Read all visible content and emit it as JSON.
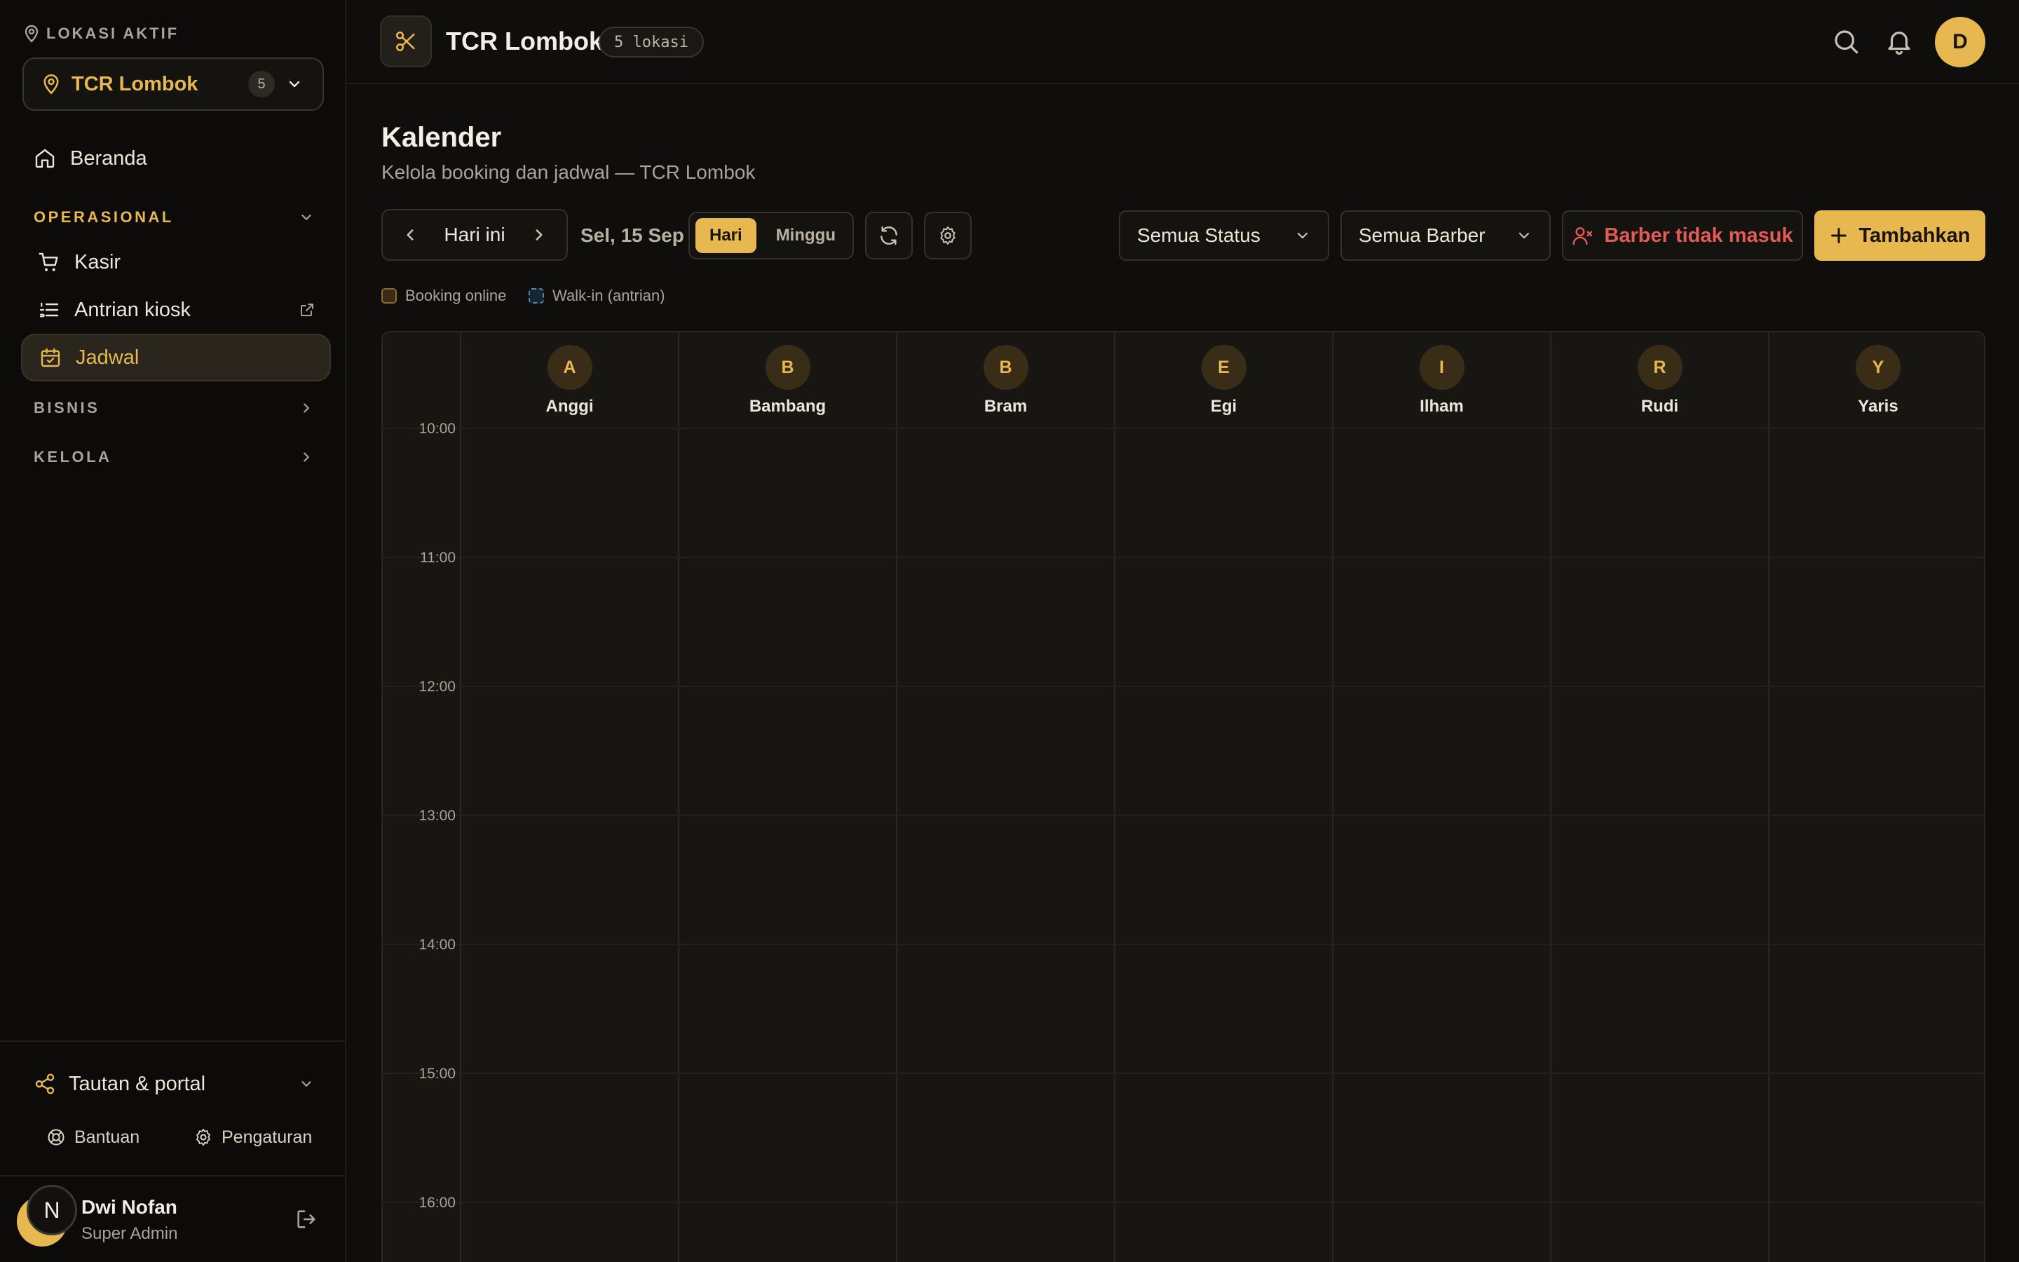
{
  "sidebar": {
    "location_label": "LOKASI AKTIF",
    "location_name": "TCR Lombok",
    "location_count": "5",
    "home": "Beranda",
    "section_operasional": "OPERASIONAL",
    "items": [
      {
        "label": "Kasir",
        "icon": "cart-icon"
      },
      {
        "label": "Antrian kiosk",
        "icon": "list-icon"
      },
      {
        "label": "Jadwal",
        "icon": "calendar-icon",
        "active": true
      }
    ],
    "section_bisnis": "BISNIS",
    "section_kelola": "KELOLA",
    "portal": "Tautan & portal",
    "help": "Bantuan",
    "settings": "Pengaturan",
    "user": {
      "initial": "N",
      "name": "Dwi Nofan",
      "role": "Super Admin"
    }
  },
  "header": {
    "brand": "TCR Lombok",
    "locations_pill": "5 lokasi",
    "avatar_initial": "D"
  },
  "page": {
    "title": "Kalender",
    "subtitle": "Kelola booking dan jadwal — TCR Lombok"
  },
  "toolbar": {
    "today": "Hari ini",
    "date": "Sel, 15 Sep",
    "view_day": "Hari",
    "view_week": "Minggu",
    "active_view": "Hari",
    "status_filter": "Semua Status",
    "barber_filter": "Semua Barber",
    "absent_button": "Barber tidak masuk",
    "add_button": "Tambahkan"
  },
  "legend": {
    "online": "Booking online",
    "walkin": "Walk-in (antrian)"
  },
  "calendar": {
    "barbers": [
      {
        "initial": "A",
        "name": "Anggi"
      },
      {
        "initial": "B",
        "name": "Bambang"
      },
      {
        "initial": "B",
        "name": "Bram"
      },
      {
        "initial": "E",
        "name": "Egi"
      },
      {
        "initial": "I",
        "name": "Ilham"
      },
      {
        "initial": "R",
        "name": "Rudi"
      },
      {
        "initial": "Y",
        "name": "Yaris"
      }
    ],
    "hours": [
      "10:00",
      "11:00",
      "12:00",
      "13:00",
      "14:00",
      "15:00",
      "16:00"
    ]
  },
  "colors": {
    "accent": "#e6b84f",
    "danger": "#e35a57",
    "background": "#0f0e0c",
    "panel": "#181612"
  }
}
